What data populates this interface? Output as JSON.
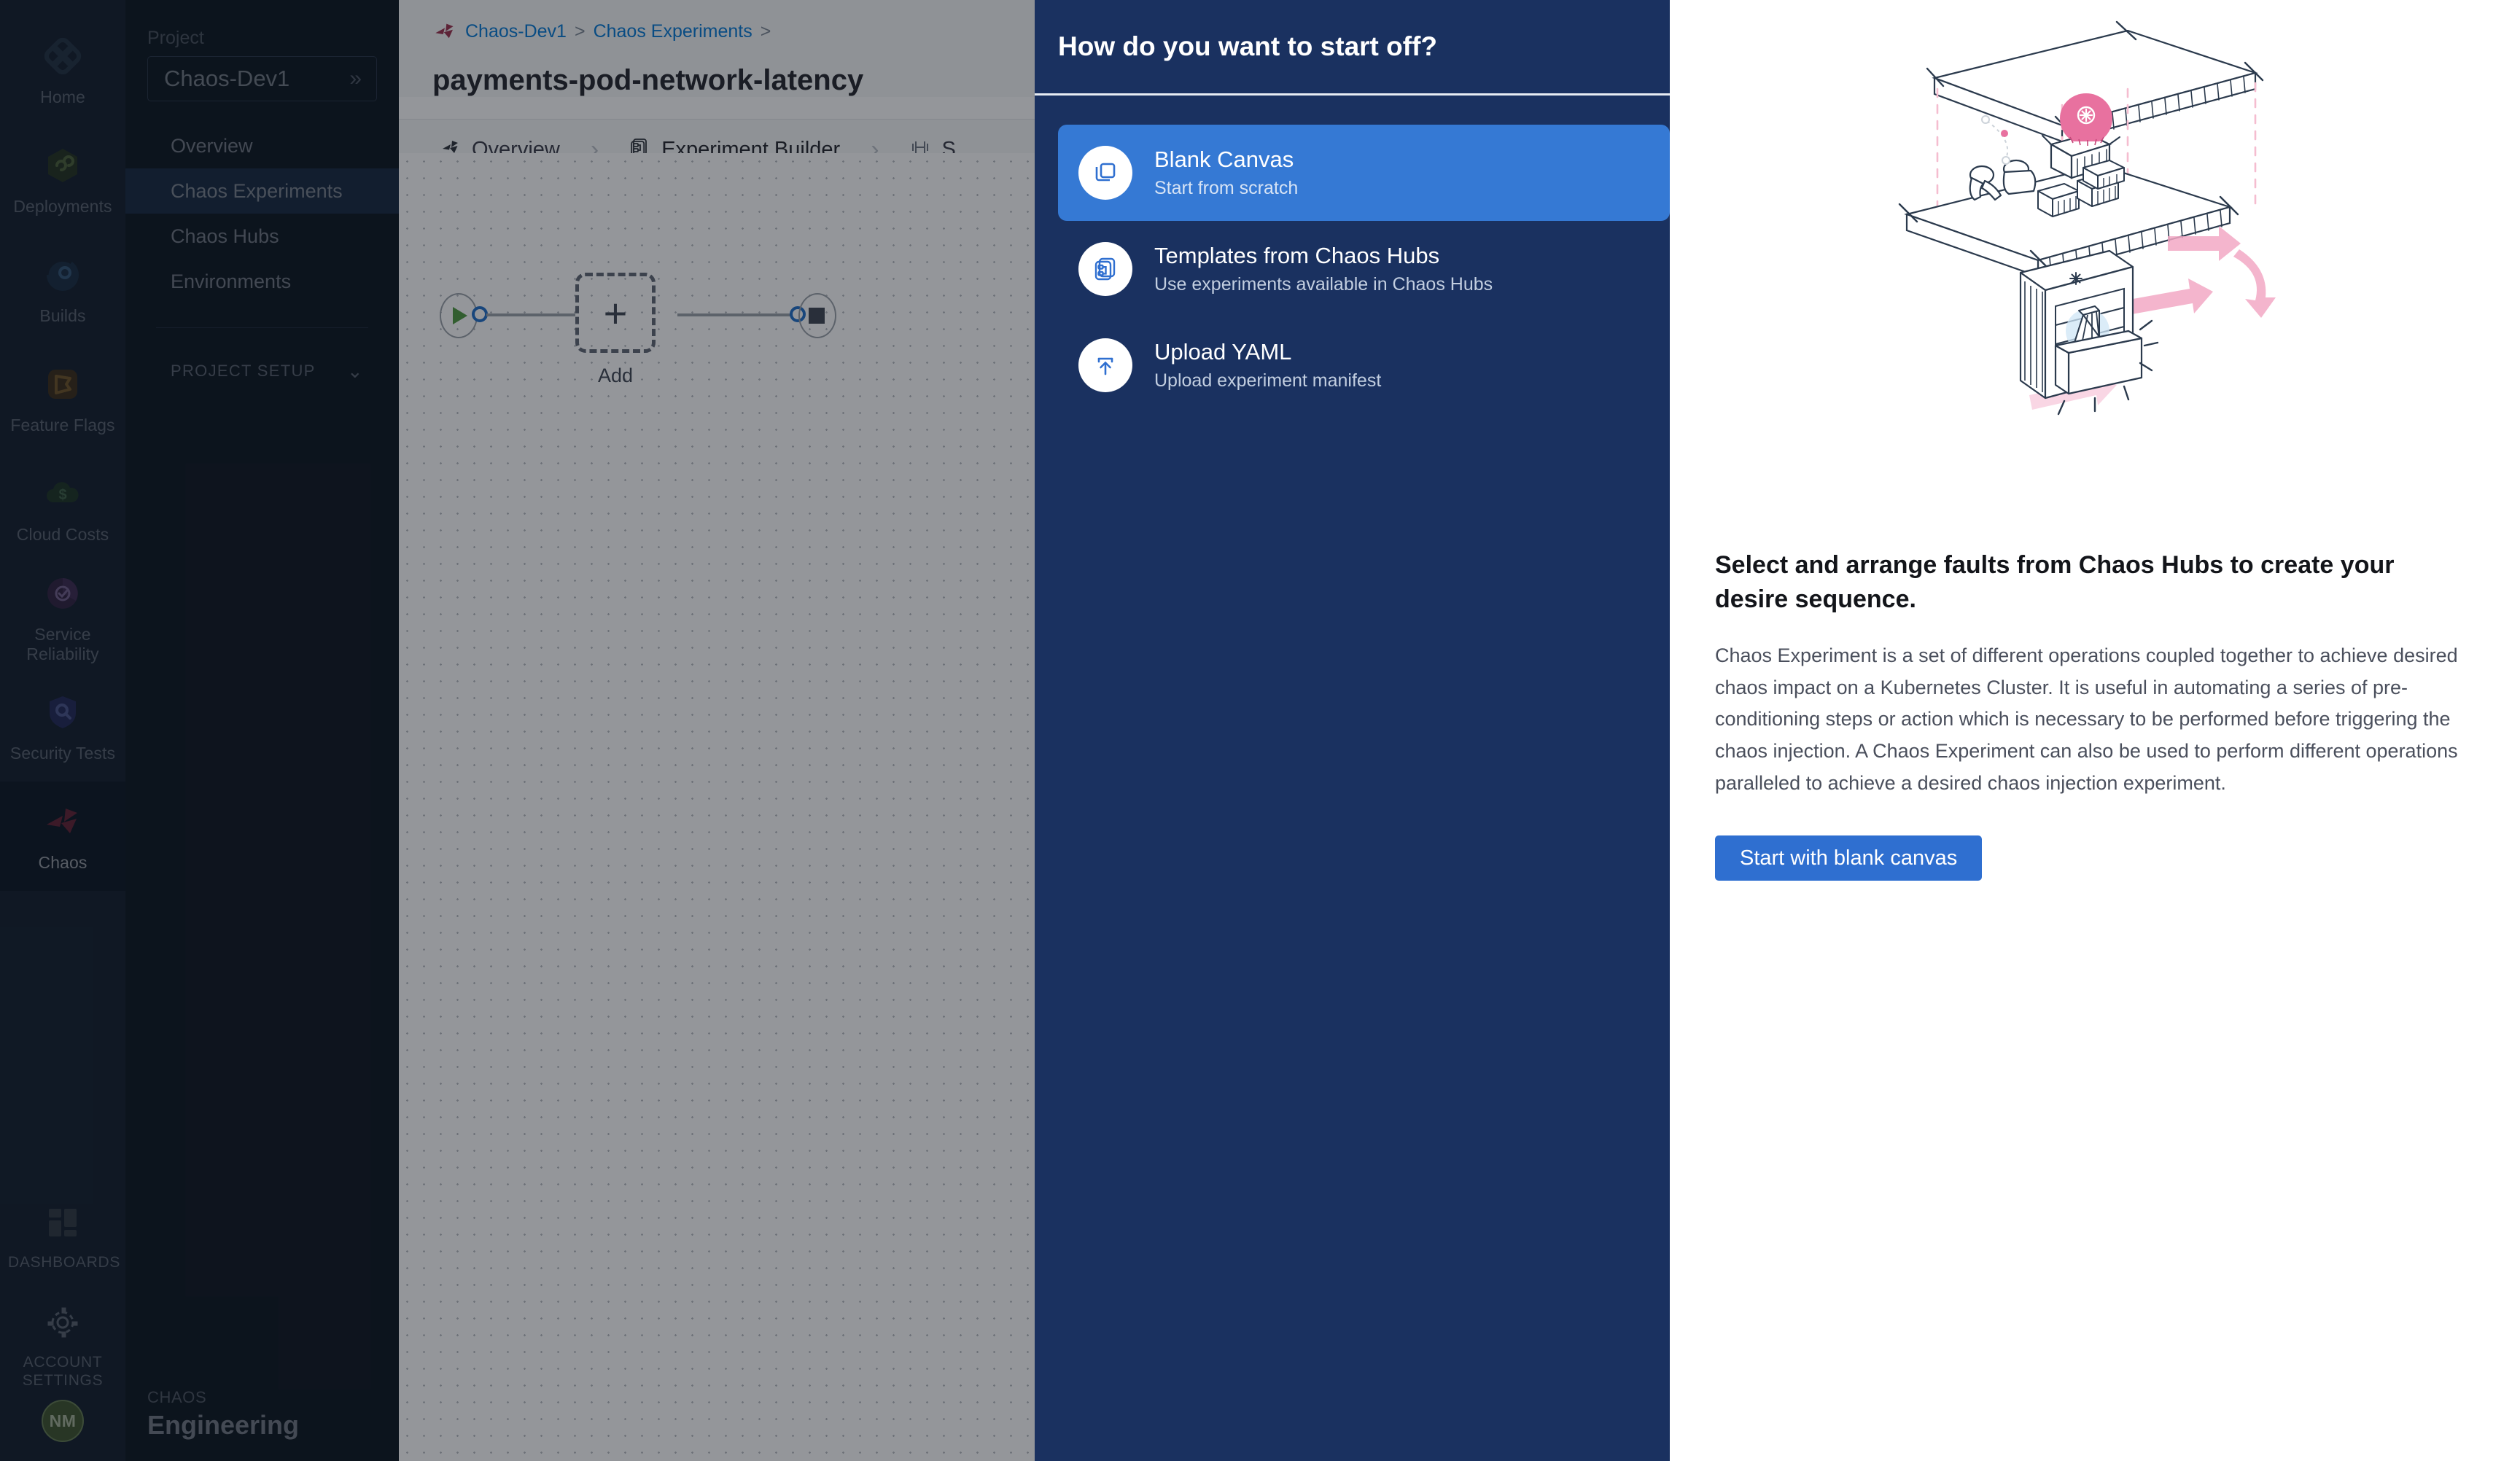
{
  "icon_nav": {
    "items": [
      {
        "label": "Home",
        "icon": "home-module-icon",
        "active": false
      },
      {
        "label": "Deployments",
        "icon": "deployments-infinity-icon",
        "active": false
      },
      {
        "label": "Builds",
        "icon": "builds-icon",
        "active": false
      },
      {
        "label": "Feature Flags",
        "icon": "feature-flags-icon",
        "active": false
      },
      {
        "label": "Cloud Costs",
        "icon": "cloud-costs-icon",
        "active": false
      },
      {
        "label": "Service Reliability",
        "icon": "service-reliability-icon",
        "active": false
      },
      {
        "label": "Security Tests",
        "icon": "security-tests-shield-icon",
        "active": false
      },
      {
        "label": "Chaos",
        "icon": "chaos-icon",
        "active": true
      }
    ],
    "bottom_items": [
      {
        "label": "DASHBOARDS",
        "icon": "dashboards-grid-icon"
      },
      {
        "label": "ACCOUNT SETTINGS",
        "icon": "gear-icon"
      }
    ],
    "avatar_initials": "NM"
  },
  "project_nav": {
    "project_label": "Project",
    "project_value": "Chaos-Dev1",
    "items": [
      {
        "label": "Overview",
        "active": false
      },
      {
        "label": "Chaos Experiments",
        "active": true
      },
      {
        "label": "Chaos Hubs",
        "active": false
      },
      {
        "label": "Environments",
        "active": false
      }
    ],
    "section_label": "PROJECT SETUP",
    "footer_small": "CHAOS",
    "footer_large": "Engineering"
  },
  "main": {
    "breadcrumb": [
      {
        "text": "Chaos-Dev1",
        "type": "link"
      },
      {
        "text": ">",
        "type": "sep"
      },
      {
        "text": "Chaos Experiments",
        "type": "link"
      },
      {
        "text": ">",
        "type": "sep"
      }
    ],
    "page_title": "payments-pod-network-latency",
    "tabs": [
      {
        "label": "Overview",
        "icon": "chaos-icon",
        "active": false
      },
      {
        "label": "Experiment Builder",
        "icon": "experiment-builder-icon",
        "active": true
      },
      {
        "label": "S",
        "icon": "resilience-probe-icon",
        "active": false
      }
    ],
    "tab_arrow": "›",
    "canvas": {
      "add_node_glyph": "+",
      "add_node_label": "Add"
    }
  },
  "modal": {
    "title": "How do you want to start off?",
    "options": [
      {
        "title": "Blank Canvas",
        "subtitle": "Start from scratch",
        "icon": "layers-copy-icon",
        "selected": true
      },
      {
        "title": "Templates from Chaos Hubs",
        "subtitle": "Use experiments available in Chaos Hubs",
        "icon": "template-card-icon",
        "selected": false
      },
      {
        "title": "Upload YAML",
        "subtitle": "Upload experiment manifest",
        "icon": "upload-icon",
        "selected": false
      }
    ],
    "detail": {
      "illustration": "isometric-chaos-lab-illustration",
      "heading": "Select and arrange faults from Chaos Hubs to create your desire sequence.",
      "body": "Chaos Experiment is a set of different operations coupled together to achieve desired chaos impact on a Kubernetes Cluster. It is useful in automating a series of pre-conditioning steps or action which is necessary to be performed before triggering the chaos injection. A Chaos Experiment can also be used to perform different operations paralleled to achieve a desired chaos injection experiment.",
      "cta_label": "Start with blank canvas"
    }
  },
  "colors": {
    "accent_blue": "#2f6fd0",
    "modal_panel": "#1a3160",
    "selected_option": "#3579d4",
    "nav_bg": "#16263b",
    "active_tab_underline": "#0b3a8a"
  }
}
